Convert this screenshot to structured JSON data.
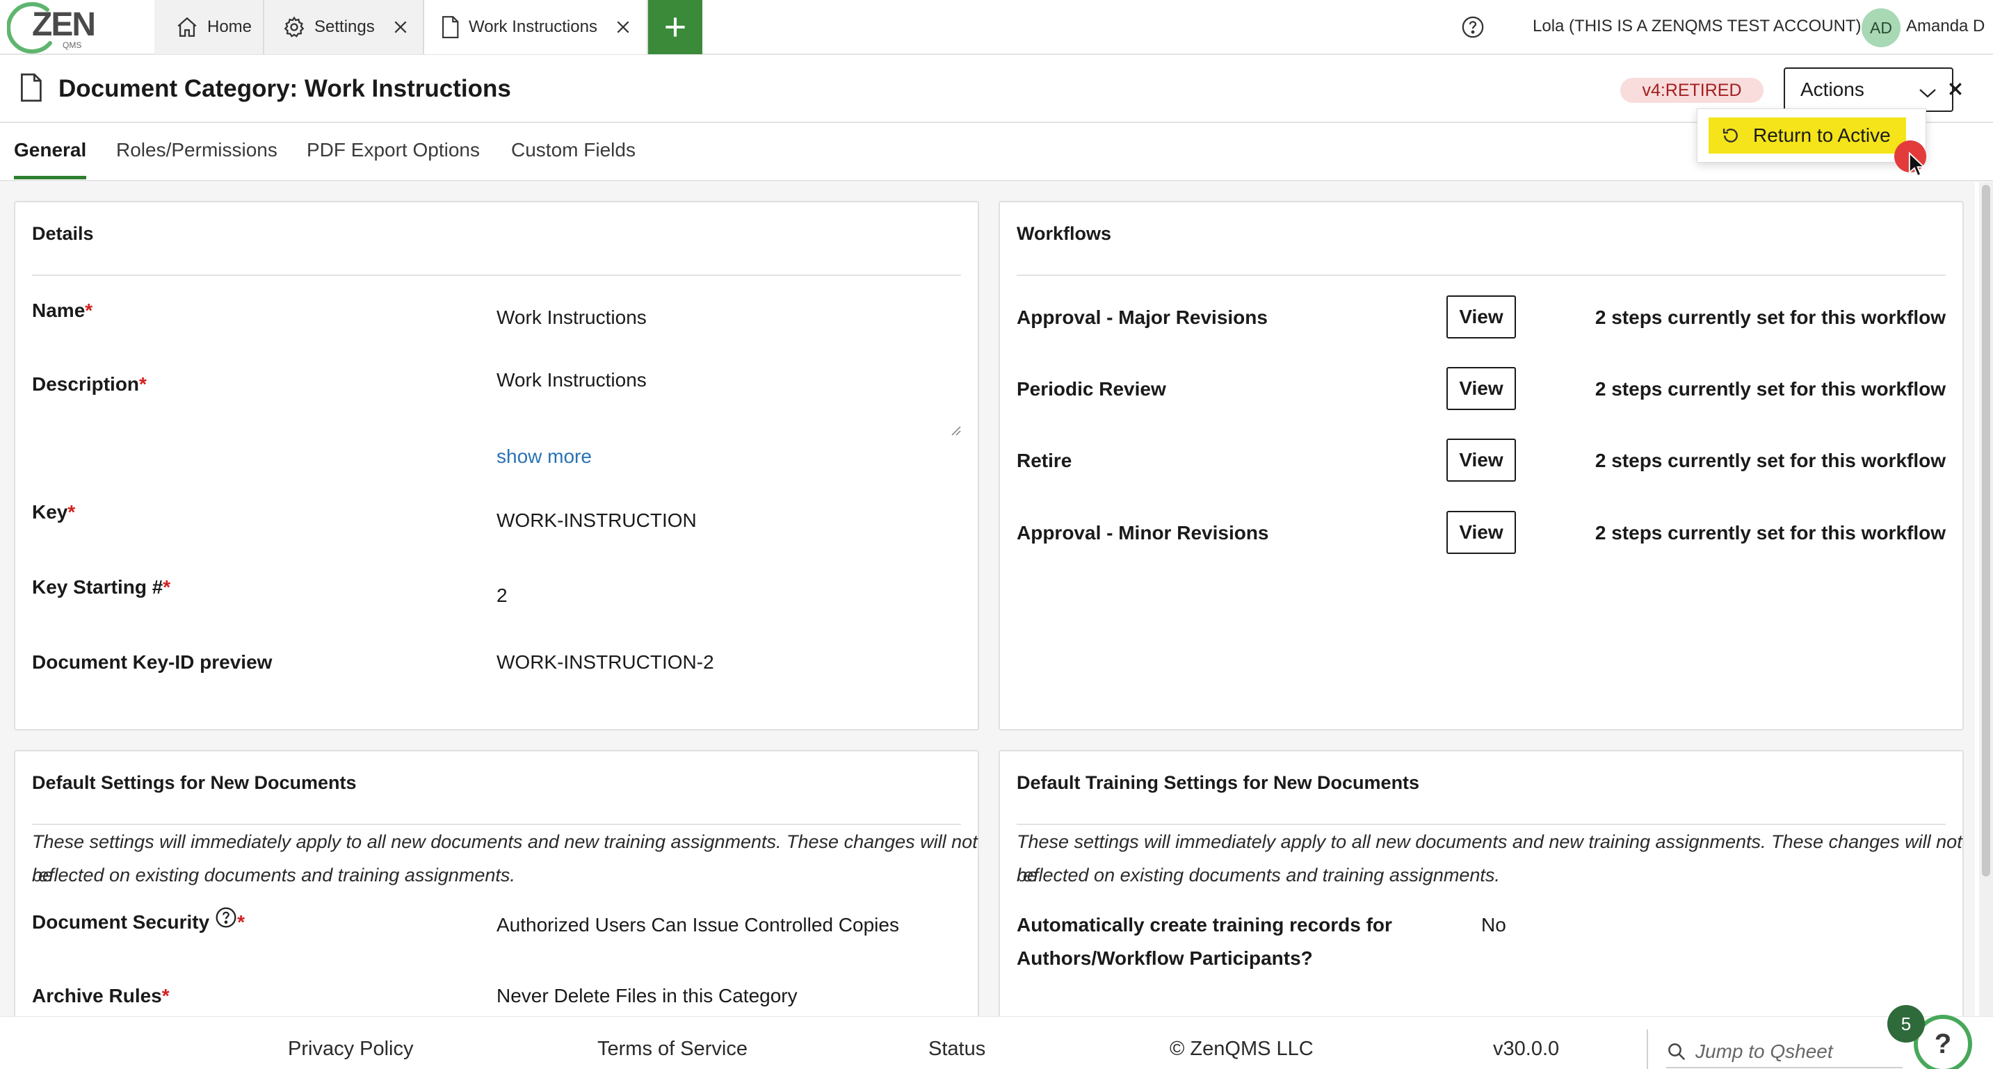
{
  "topbar": {
    "logo_text": "ZEN",
    "logo_sub": "QMS",
    "tabs": [
      {
        "label": "Home",
        "icon": "home-icon"
      },
      {
        "label": "Settings",
        "icon": "gear-icon"
      },
      {
        "label": "Work Instructions",
        "icon": "document-icon"
      }
    ],
    "account_label": "Lola (THIS IS A ZENQMS TEST ACCOUNT)",
    "avatar_initials": "AD",
    "user_name": "Amanda D"
  },
  "titlebar": {
    "title": "Document Category: Work Instructions",
    "status": "v4:RETIRED",
    "actions_label": "Actions",
    "dropdown": {
      "return_to_active": "Return to Active"
    }
  },
  "subtabs": [
    "General",
    "Roles/Permissions",
    "PDF Export Options",
    "Custom Fields"
  ],
  "details": {
    "heading": "Details",
    "name_label": "Name",
    "name_value": "Work Instructions",
    "description_label": "Description",
    "description_value": "Work Instructions",
    "show_more": "show more",
    "key_label": "Key",
    "key_value": "WORK-INSTRUCTION",
    "key_start_label": "Key Starting #",
    "key_start_value": "2",
    "preview_label": "Document Key-ID preview",
    "preview_value": "WORK-INSTRUCTION-2",
    "required_mark": "*"
  },
  "workflows": {
    "heading": "Workflows",
    "view_label": "View",
    "items": [
      {
        "name": "Approval - Major Revisions",
        "steps": "2 steps currently set for this workflow"
      },
      {
        "name": "Periodic Review",
        "steps": "2 steps currently set for this workflow"
      },
      {
        "name": "Retire",
        "steps": "2 steps currently set for this workflow"
      },
      {
        "name": "Approval - Minor Revisions",
        "steps": "2 steps currently set for this workflow"
      }
    ]
  },
  "default_settings": {
    "heading": "Default Settings for New Documents",
    "note_line1": "These settings will immediately apply to all new documents and new training assignments. These changes will not be",
    "note_line2": "reflected on existing documents and training assignments.",
    "security_label": "Document Security",
    "security_value": "Authorized Users Can Issue Controlled Copies",
    "archive_label": "Archive Rules",
    "archive_value": "Never Delete Files in this Category"
  },
  "training_settings": {
    "heading": "Default Training Settings for New Documents",
    "note_line1": "These settings will immediately apply to all new documents and new training assignments. These changes will not be",
    "note_line2": "reflected on existing documents and training assignments.",
    "auto_label_line1": "Automatically create training records for",
    "auto_label_line2": "Authors/Workflow Participants?",
    "auto_value": "No"
  },
  "footer": {
    "privacy": "Privacy Policy",
    "terms": "Terms of Service",
    "status": "Status",
    "copyright": "© ZenQMS LLC",
    "version": "v30.0.0",
    "search_placeholder": "Jump to Qsheet",
    "notification_count": "5",
    "help_glyph": "?"
  },
  "colors": {
    "brand_green": "#3a8a3a",
    "active_tab_underline": "#2f7f2f",
    "retired_pill_bg": "#f9dcdc",
    "retired_pill_text": "#a32020",
    "highlight_yellow": "#f4e419",
    "link_blue": "#2a72b5",
    "required_red": "#d42020"
  }
}
